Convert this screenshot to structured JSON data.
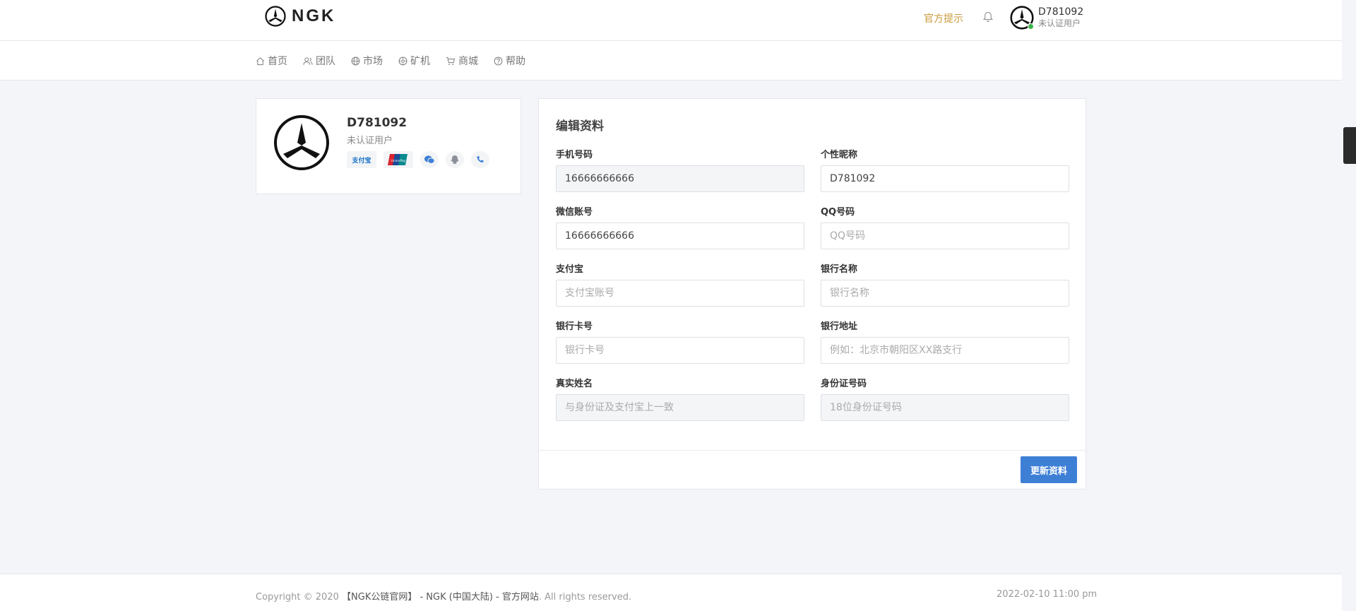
{
  "header": {
    "brand": "NGK",
    "hint_link": "官方提示",
    "user": {
      "name": "D781092",
      "status": "未认证用户"
    }
  },
  "nav": {
    "items": [
      {
        "label": "首页",
        "icon": "home-icon"
      },
      {
        "label": "团队",
        "icon": "team-icon"
      },
      {
        "label": "市场",
        "icon": "globe-icon"
      },
      {
        "label": "矿机",
        "icon": "miner-icon"
      },
      {
        "label": "商城",
        "icon": "cart-icon"
      },
      {
        "label": "帮助",
        "icon": "help-icon"
      }
    ]
  },
  "profile": {
    "name": "D781092",
    "status": "未认证用户",
    "badges": {
      "alipay": "支付宝",
      "unionpay": "UnionPay",
      "items": [
        "alipay-icon",
        "unionpay-icon",
        "wechat-icon",
        "qq-icon",
        "phone-icon"
      ]
    }
  },
  "edit_form": {
    "title": "编辑资料",
    "fields": {
      "phone": {
        "label": "手机号码",
        "value": "16666666666",
        "placeholder": ""
      },
      "nickname": {
        "label": "个性昵称",
        "value": "D781092",
        "placeholder": ""
      },
      "wechat": {
        "label": "微信账号",
        "value": "16666666666",
        "placeholder": ""
      },
      "qq": {
        "label": "QQ号码",
        "value": "",
        "placeholder": "QQ号码"
      },
      "alipay": {
        "label": "支付宝",
        "value": "",
        "placeholder": "支付宝账号"
      },
      "bank_name": {
        "label": "银行名称",
        "value": "",
        "placeholder": "银行名称"
      },
      "bank_card": {
        "label": "银行卡号",
        "value": "",
        "placeholder": "银行卡号"
      },
      "bank_address": {
        "label": "银行地址",
        "value": "",
        "placeholder": "例如：北京市朝阳区XX路支行"
      },
      "real_name": {
        "label": "真实姓名",
        "value": "",
        "placeholder": "与身份证及支付宝上一致"
      },
      "id_number": {
        "label": "身份证号码",
        "value": "",
        "placeholder": "18位身份证号码"
      }
    },
    "submit_label": "更新资料"
  },
  "footer": {
    "copyright_prefix": "Copyright © 2020",
    "brand_link": "【NGK公链官网】 - NGK (中国大陆) - 官方网站",
    "copyright_suffix": ". All rights reserved.",
    "time": "2022-02-10 11:00 pm"
  },
  "colors": {
    "accent": "#3e7fd6",
    "hint": "#c99a3a",
    "online": "#3cb44b",
    "background": "#f4f5f8"
  }
}
